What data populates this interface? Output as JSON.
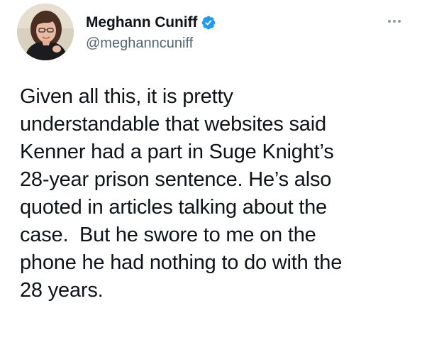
{
  "author": {
    "display_name": "Meghann Cuniff",
    "handle": "@meghanncuniff",
    "avatar_icon": "profile-photo",
    "verified_icon": "verified-badge-icon",
    "verified_color": "#1d9bf0"
  },
  "tweet": {
    "lines": [
      "Given all this, it is pretty",
      "understandable that websites said",
      "Kenner had a part in Suge Knight’s",
      "28-year prison sentence. He’s also",
      "quoted in articles talking about the",
      "case.  But he swore to me on the",
      "phone he had nothing to do with the",
      "28 years."
    ]
  },
  "menu": {
    "more_icon": "more-options-icon"
  },
  "colors": {
    "text": "#0f1419",
    "secondary_text": "#536471",
    "background": "#ffffff"
  }
}
